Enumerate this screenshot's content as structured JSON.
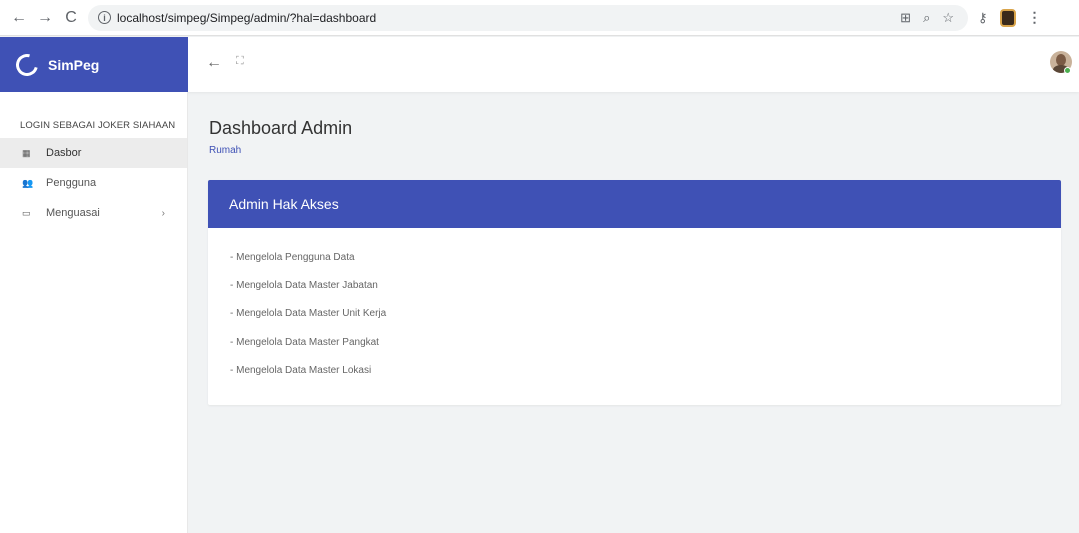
{
  "browser": {
    "url": "localhost/simpeg/Simpeg/admin/?hal=dashboard",
    "back_icon": "arrow-left",
    "forward_icon": "arrow-right",
    "reload_icon": "reload",
    "back_glyph": "←",
    "forward_glyph": "→",
    "reload_glyph": "C",
    "info_glyph": "i",
    "zoom_glyph": "⌕",
    "star_glyph": "☆",
    "key_glyph": "⚷",
    "menu_glyph": "⋮"
  },
  "app": {
    "brand": "SimPeg",
    "header_back_glyph": "←",
    "header_expand_glyph": "⛶",
    "accent_color": "#3f51b5",
    "status_color": "#4caf50"
  },
  "sidebar": {
    "login_label": "LOGIN SEBAGAI JOKER SIAHAAN",
    "items": [
      {
        "label": "Dasbor",
        "icon": "dashboard-grid-icon",
        "glyph": "▦",
        "active": true
      },
      {
        "label": "Pengguna",
        "icon": "users-icon",
        "glyph": "👥",
        "active": false
      },
      {
        "label": "Menguasai",
        "icon": "folder-icon",
        "glyph": "▭",
        "active": false,
        "chevron": "›"
      }
    ]
  },
  "main": {
    "title": "Dashboard Admin",
    "breadcrumb": "Rumah",
    "card": {
      "title": "Admin Hak Akses",
      "lines": [
        "- Mengelola Pengguna Data",
        "- Mengelola Data Master Jabatan",
        "- Mengelola Data Master Unit Kerja",
        "- Mengelola Data Master Pangkat",
        "- Mengelola Data Master Lokasi"
      ]
    }
  }
}
